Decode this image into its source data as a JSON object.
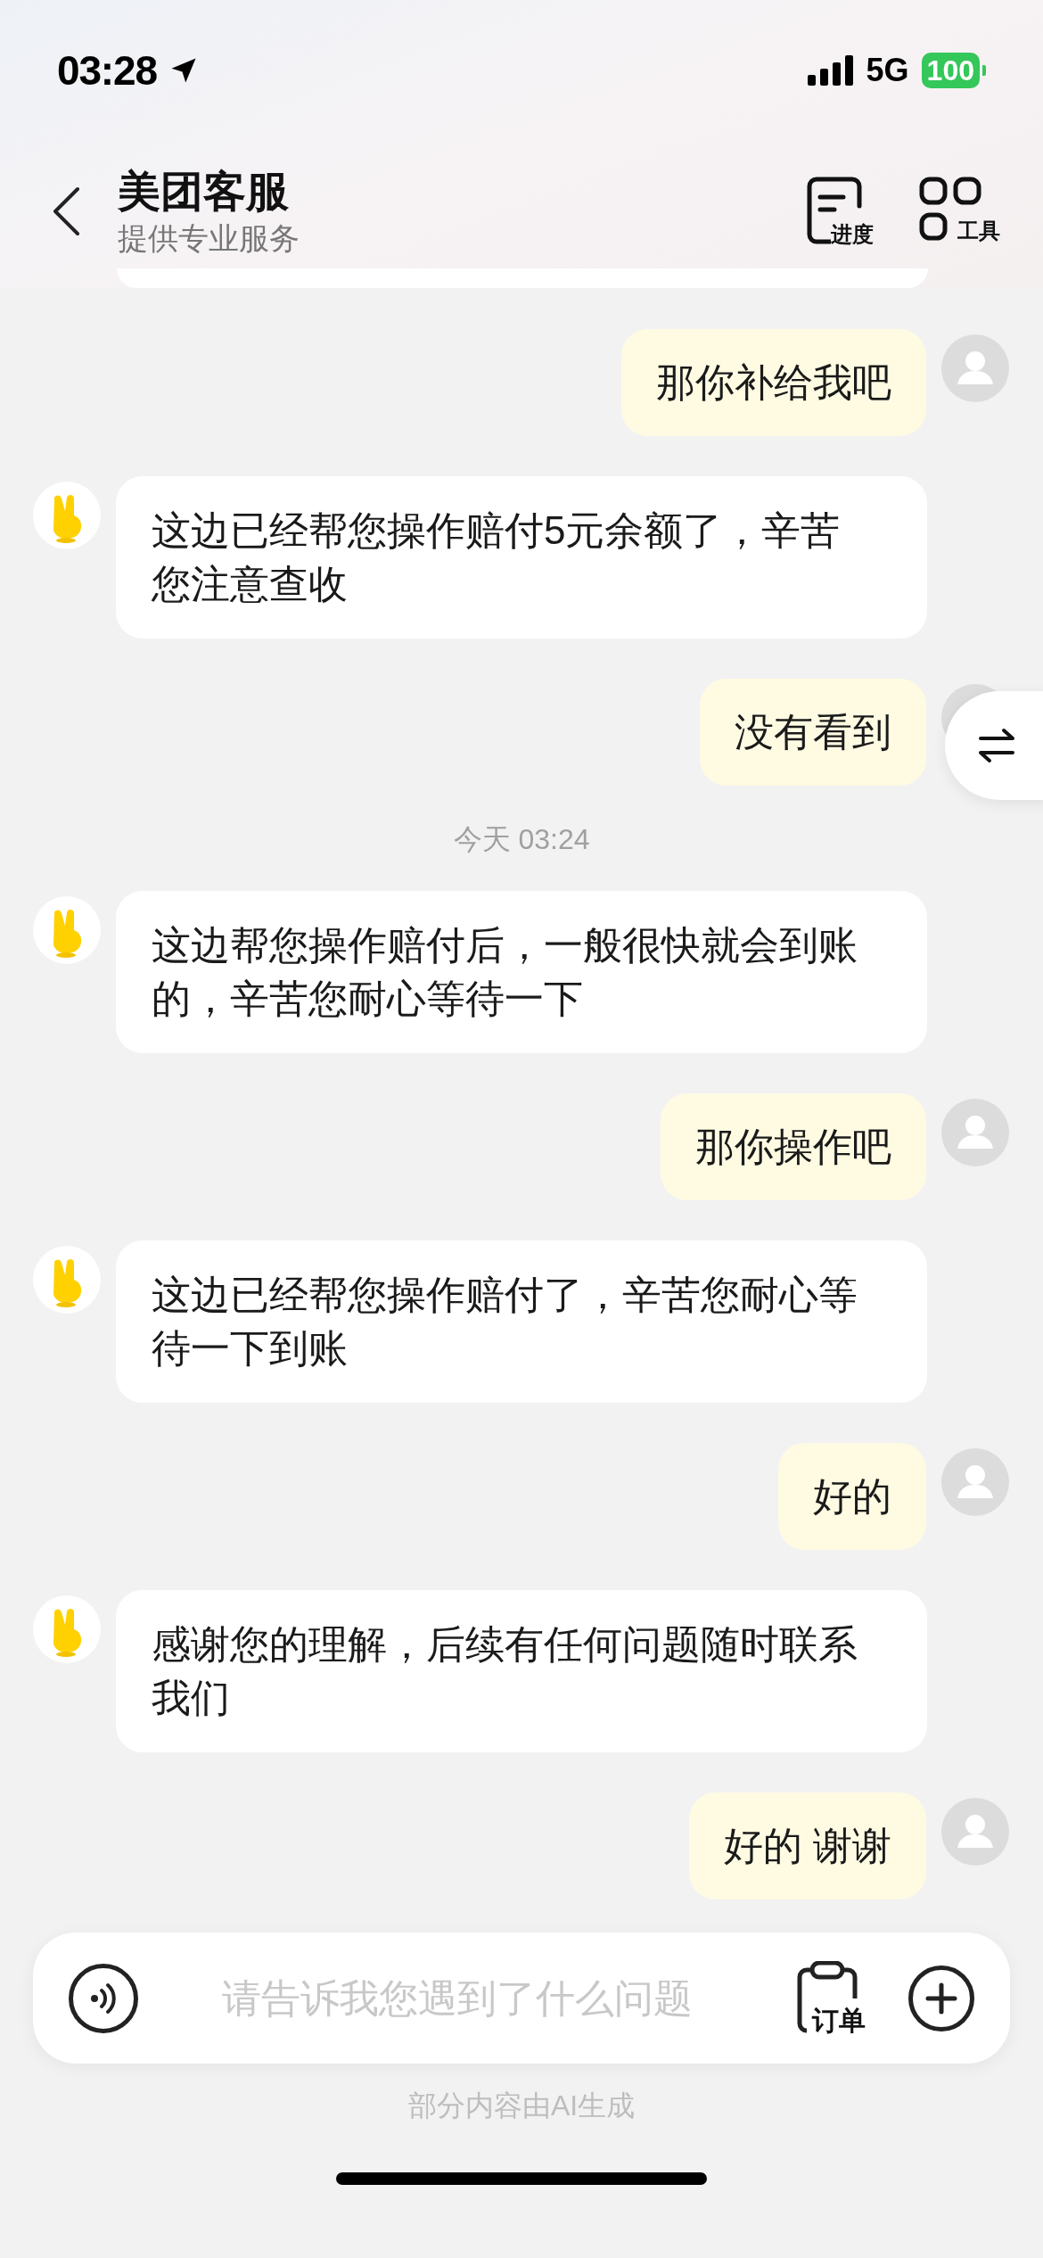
{
  "status_bar": {
    "time": "03:28",
    "network": "5G",
    "battery": "100"
  },
  "header": {
    "title": "美团客服",
    "subtitle": "提供专业服务",
    "actions": [
      {
        "kind": "progress",
        "label": "进度"
      },
      {
        "kind": "tools",
        "label": "工具"
      }
    ]
  },
  "messages": [
    {
      "kind": "user",
      "text": "那你补给我吧"
    },
    {
      "kind": "agent",
      "text": "这边已经帮您操作赔付5元余额了，辛苦您注意查收"
    },
    {
      "kind": "user",
      "text": "没有看到"
    },
    {
      "kind": "time",
      "text": "今天 03:24"
    },
    {
      "kind": "agent",
      "text": "这边帮您操作赔付后，一般很快就会到账的，辛苦您耐心等待一下"
    },
    {
      "kind": "user",
      "text": "那你操作吧"
    },
    {
      "kind": "agent",
      "text": "这边已经帮您操作赔付了，辛苦您耐心等待一下到账"
    },
    {
      "kind": "user",
      "text": "好的"
    },
    {
      "kind": "agent",
      "text": "感谢您的理解，后续有任何问题随时联系我们"
    },
    {
      "kind": "user",
      "text": "好的 谢谢"
    }
  ],
  "input": {
    "placeholder": "请告诉我您遇到了什么问题",
    "order_label": "订单"
  },
  "footer_note": "部分内容由AI生成"
}
